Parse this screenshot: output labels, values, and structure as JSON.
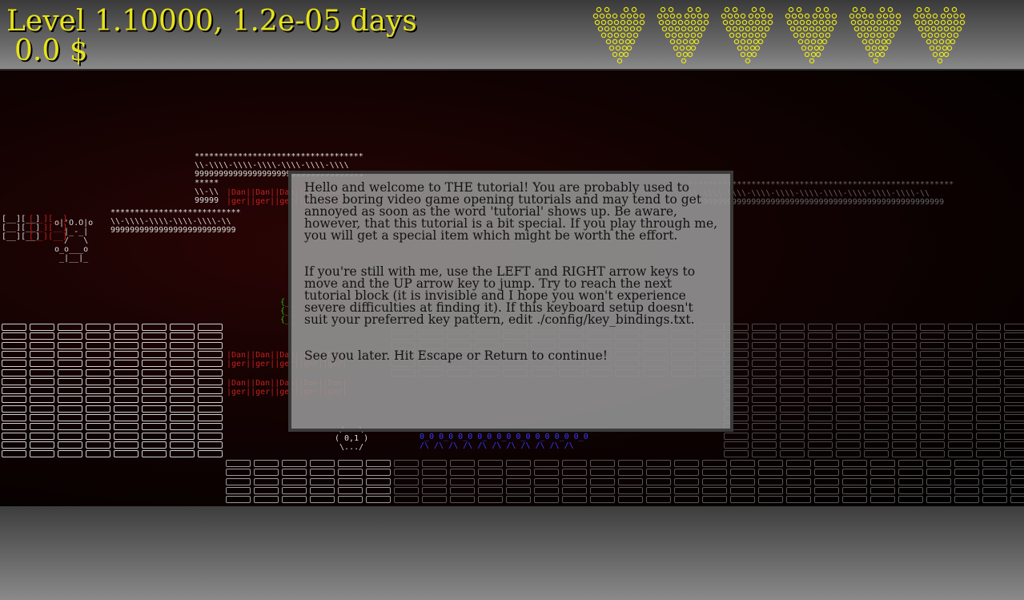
{
  "hud": {
    "level_text": "Level 1.10000, 1.2e-05 days",
    "money_text": " 0.0 $",
    "lives": 6,
    "life_icon": "ascii-heart-icon",
    "text_color": "#e6e21a"
  },
  "dialog": {
    "paragraphs": [
      "Hello and welcome to THE tutorial! You are probably used to these boring video game opening tutorials and may tend to get annoyed as soon as the word 'tutorial' shows up. Be aware, however, that this tutorial is a bit special. If you play through me, you will get a special item which might be worth the effort.",
      "If you're still with me, use the LEFT and RIGHT arrow keys to move and the UP arrow key to jump. Try to reach the next tutorial block (it is invisible and I hope you won't experience severe difficulties at finding it). If this keyboard setup doesn't suit your preferred key pattern, edit ./config/key_bindings.txt.",
      "See you later. Hit Escape or Return to continue!"
    ]
  },
  "level": {
    "stairs_top": "***********************************\n\\\\-\\\\\\\\-\\\\\\\\-\\\\\\\\-\\\\\\\\-\\\\\\\\-\\\\\\\\\n99999999999999999999999999999999999",
    "stairs_mid": "*****\n\\\\-\\\\\n99999",
    "stairs_low": "***************************\n\\\\-\\\\\\\\-\\\\\\\\-\\\\\\\\-\\\\\\\\-\\\\\n99999999999999999999999999",
    "right_platform": "*******************************************************\n\\\\-\\\\\\\\-\\\\\\\\-\\\\\\\\-\\\\\\\\-\\\\\\\\-\\\\\\\\-\\\\\\\\-\\\\\\\\-\\\\\\\\-\\\\\n99999999999999999999999999999999999999999999999999999",
    "player": "o|'O.O|o\n  |_-_|\n  /   \\\no_o___o\n _|__|_",
    "blocks_left": "[__][__]\n[__][__]\n[__][__]",
    "dan_ger_row": "|Dan||Dan||Dan||Dan||Dan|\n|ger||ger||ger||ger||ger|",
    "enemy": " /.-.\\\n( 0,1 )\n \\.../",
    "blue_row": "0_0 0_0 0_0 0_0 0_0 0_0 0_0 0_0 0_0\n/\\ /\\ /\\ /\\ /\\ /\\ /\\ /\\ /\\ /\\ /\\"
  }
}
